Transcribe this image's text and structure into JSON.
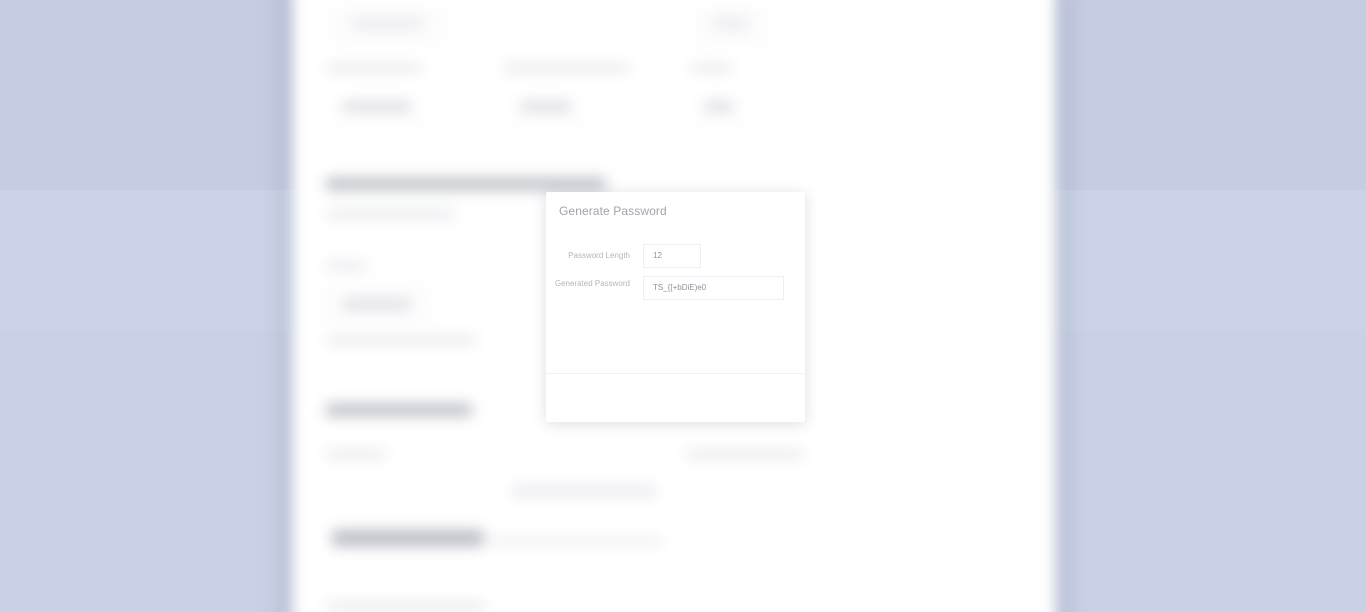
{
  "dialog": {
    "title": "Generate Password",
    "fields": {
      "length_label": "Password Length",
      "length_value": "12",
      "generated_label": "Generated Password",
      "generated_value": "TS_{[+bDiE)e0"
    }
  },
  "colors": {
    "backdrop": "#c9d1e6",
    "page": "#ffffff",
    "dialog": "#ffffff"
  }
}
